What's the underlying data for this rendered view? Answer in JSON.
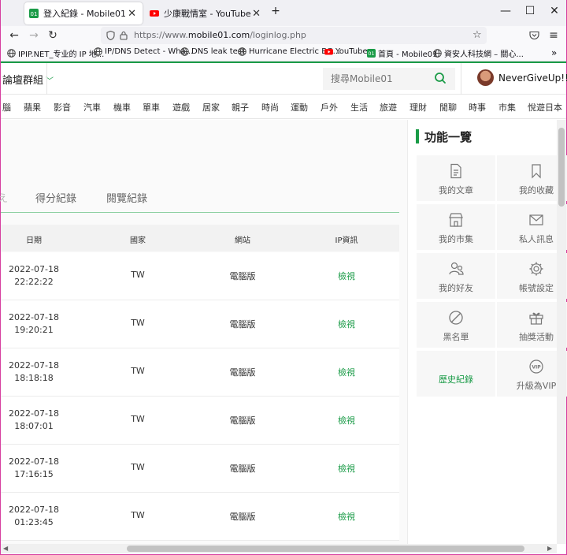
{
  "browser": {
    "tabs": [
      {
        "title": "登入紀錄 - Mobile01",
        "active": true
      },
      {
        "title": "少康戰情室 - YouTube",
        "active": false
      }
    ],
    "new_tab": "+",
    "url_host_prefix": "https://www.",
    "url_domain": "mobile01.com",
    "url_path": "/loginlog.php",
    "bookmarks": [
      "IPIP.NET_专业的 IP 地...",
      "IP/DNS Detect - Wha...",
      "DNS leak test",
      "Hurricane Electric BG...",
      "YouTube",
      "首頁 - Mobile01",
      "資安人科技網 – 關心..."
    ],
    "overflow": "»"
  },
  "header": {
    "forum_group": "論壇群組",
    "search_placeholder": "搜尋Mobile01",
    "username": "NeverGiveUp!!"
  },
  "categories": [
    "腦",
    "蘋果",
    "影音",
    "汽車",
    "機車",
    "單車",
    "遊戲",
    "居家",
    "親子",
    "時尚",
    "運動",
    "戶外",
    "生活",
    "旅遊",
    "理財",
    "閒聊",
    "時事",
    "市集",
    "悅遊日本"
  ],
  "content": {
    "tabs": [
      "得分紀錄",
      "閱覽紀錄"
    ],
    "tab_partial": "え",
    "table": {
      "headers": [
        "日期",
        "國家",
        "網站",
        "IP資訊"
      ],
      "rows": [
        {
          "date": "2022-07-18",
          "time": "22:22:22",
          "country": "TW",
          "site": "電腦版",
          "ip": "檢視"
        },
        {
          "date": "2022-07-18",
          "time": "19:20:21",
          "country": "TW",
          "site": "電腦版",
          "ip": "檢視"
        },
        {
          "date": "2022-07-18",
          "time": "18:18:18",
          "country": "TW",
          "site": "電腦版",
          "ip": "檢視"
        },
        {
          "date": "2022-07-18",
          "time": "18:07:01",
          "country": "TW",
          "site": "電腦版",
          "ip": "檢視"
        },
        {
          "date": "2022-07-18",
          "time": "17:16:15",
          "country": "TW",
          "site": "電腦版",
          "ip": "檢視"
        },
        {
          "date": "2022-07-18",
          "time": "01:23:45",
          "country": "TW",
          "site": "電腦版",
          "ip": "檢視"
        }
      ]
    }
  },
  "sidebar": {
    "title": "功能一覽",
    "features": [
      {
        "label": "我的文章",
        "icon": "document-icon"
      },
      {
        "label": "我的收藏",
        "icon": "bookmark-icon"
      },
      {
        "label": "我的市集",
        "icon": "store-icon"
      },
      {
        "label": "私人訊息",
        "icon": "mail-icon"
      },
      {
        "label": "我的好友",
        "icon": "friends-icon"
      },
      {
        "label": "帳號設定",
        "icon": "gear-icon"
      },
      {
        "label": "黑名單",
        "icon": "block-icon"
      },
      {
        "label": "抽獎活動",
        "icon": "gift-icon"
      },
      {
        "label": "歷史紀錄",
        "icon": ""
      },
      {
        "label": "升級為VIP",
        "icon": "vip-icon"
      }
    ]
  },
  "colors": {
    "accent": "#1a9b47"
  }
}
